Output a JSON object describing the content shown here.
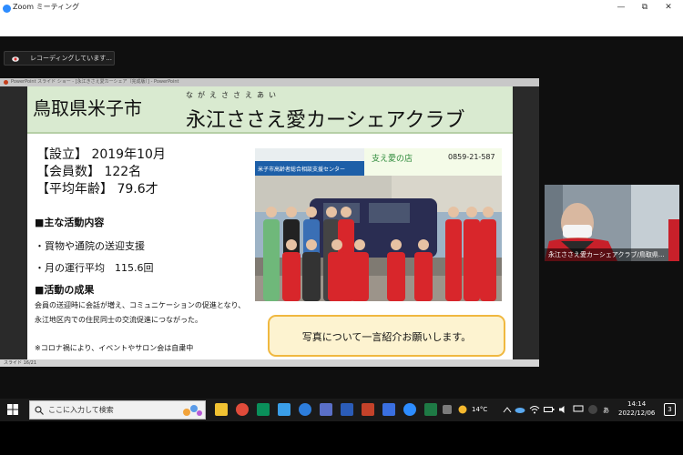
{
  "zoom": {
    "title": "Zoom ミーティング",
    "recording_text": "レコーディングしています...",
    "window_controls": {
      "minimize": "—",
      "maximize": "⧉",
      "close": "✕"
    }
  },
  "powerpoint": {
    "title_bar": "PowerPoint スライド ショー - [永江きさえ愛カーシェア（完成版）] - PowerPoint",
    "status_bar": "スライド 16/21"
  },
  "slide": {
    "city": "鳥取県米子市",
    "ruby": "ながえささえあい",
    "club_name": "永江ささえ愛カーシェアクラブ",
    "facts": [
      "【設立】 2019年10月",
      "【会員数】 122名",
      "【平均年齢】 79.6才"
    ],
    "activities_heading": "■主な活動内容",
    "activities": [
      "・買物や通院の送迎支援",
      "・月の運行平均　115.6回"
    ],
    "results_heading": "■活動の成果",
    "results_lines": [
      "会員の送迎時に会話が増え、コミュニケーションの促進となり、",
      "永江地区内での住民同士の交流促進につながった。"
    ],
    "note": "※コロナ禍により、イベントやサロン会は自粛中",
    "photo": {
      "sign_phone": "0859-21-587",
      "sign_shop": "支え愛の店",
      "sign_center": "米子市高齢者総合相談支援センター"
    },
    "callout": "写真について一言紹介お願いします。"
  },
  "participant": {
    "name": "永江ささえ愛カーシェアクラブ/鳥取県..."
  },
  "taskbar": {
    "search_placeholder": "ここに入力して検索",
    "weather": "14°C",
    "time": "14:14",
    "date": "2022/12/06",
    "ime": "あ",
    "notification_count": "3"
  },
  "colors": {
    "zoom_blue": "#2D8CFF",
    "banner_green": "#d9ead0",
    "callout_fill": "#fdf3d0",
    "callout_border": "#f0b840",
    "vest_red": "#d8262b"
  }
}
